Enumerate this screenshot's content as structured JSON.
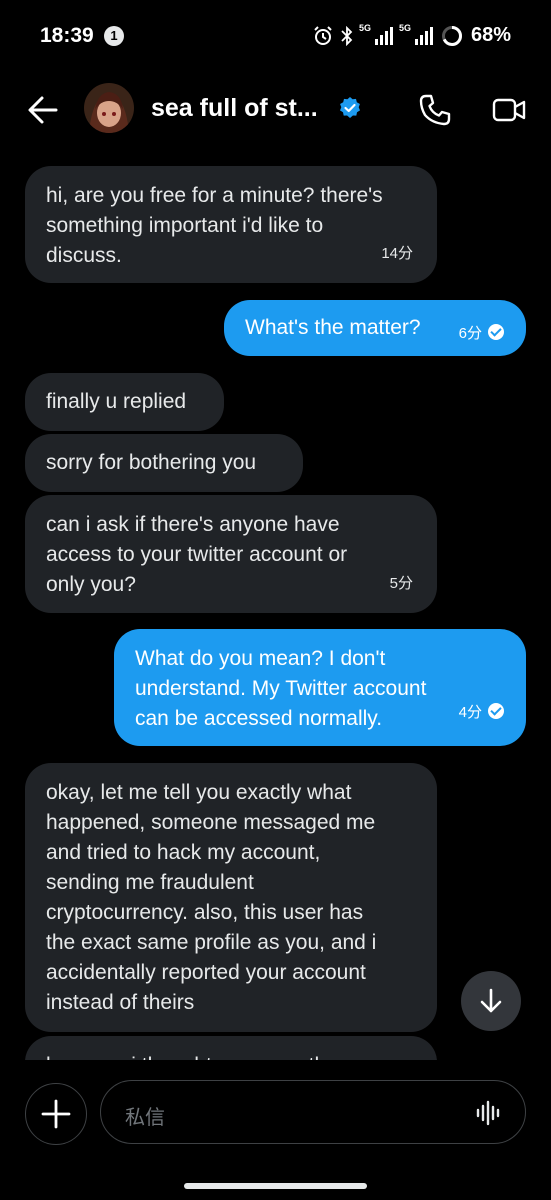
{
  "status_bar": {
    "time": "18:39",
    "notification_count": "1",
    "network_1": "5G",
    "network_2": "5G",
    "battery": "68%"
  },
  "header": {
    "name": "sea full of st...",
    "verified": true
  },
  "messages": [
    {
      "id": "m1",
      "direction": "received",
      "lines": [
        "hi, are you free for a minute? there's",
        "something important i'd like to",
        "discuss."
      ],
      "time": "14分"
    },
    {
      "id": "m2",
      "direction": "sent",
      "lines": [
        "What's the matter?"
      ],
      "time": "6分"
    },
    {
      "id": "m3",
      "direction": "received",
      "lines": [
        "finally u replied"
      ]
    },
    {
      "id": "m4",
      "direction": "received",
      "lines": [
        "sorry for bothering you"
      ]
    },
    {
      "id": "m5",
      "direction": "received",
      "lines": [
        "can i ask if there's anyone have",
        "access to your twitter account or",
        "only you?"
      ],
      "time": "5分"
    },
    {
      "id": "m6",
      "direction": "sent",
      "lines": [
        "What do you mean? I don't",
        "understand. My Twitter account",
        "can be accessed normally."
      ],
      "time": "4分"
    },
    {
      "id": "m7",
      "direction": "received",
      "lines": [
        "okay, let me tell you exactly what",
        "happened, someone messaged me",
        "and tried to hack my account,",
        "sending me fraudulent",
        "cryptocurrency. also, this user has",
        "the exact same profile as you, and i",
        "accidentally reported your account",
        "instead of theirs"
      ]
    },
    {
      "id": "m8",
      "direction": "received",
      "lines": [
        "because i thought you were the one"
      ]
    }
  ],
  "composer": {
    "placeholder": "私信"
  },
  "colors": {
    "background": "#000000",
    "received_bubble": "#202327",
    "sent_bubble": "#1d9bf0",
    "verified_badge": "#1d9bf0"
  },
  "icons": [
    "back-arrow-icon",
    "verified-badge-icon",
    "phone-icon",
    "video-camera-icon",
    "arrow-down-icon",
    "plus-icon",
    "voice-wave-icon",
    "alarm-icon",
    "bluetooth-icon",
    "signal-icon"
  ]
}
